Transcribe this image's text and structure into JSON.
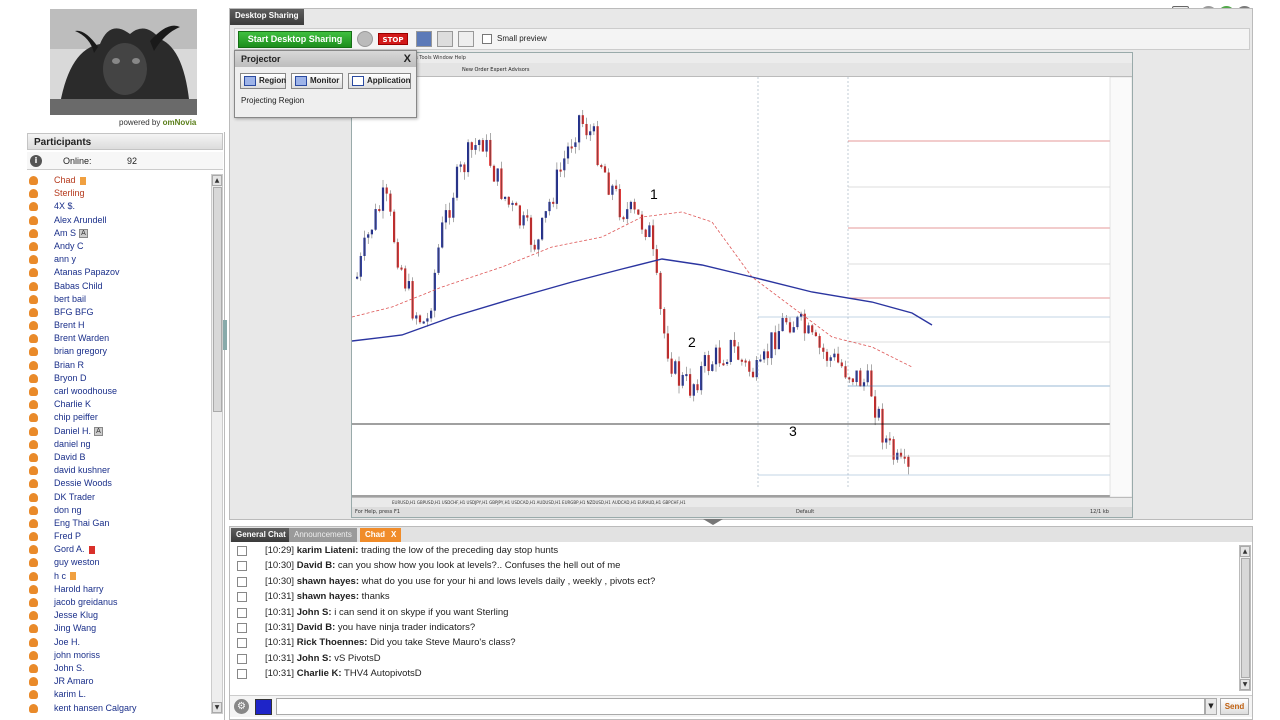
{
  "logo": {
    "powered_by": "powered by",
    "brand": "omNovia"
  },
  "participants": {
    "header": "Participants",
    "online_label": "Online:",
    "online_count": "92",
    "items": [
      {
        "name": "Chad",
        "hl": true,
        "badge": "orange"
      },
      {
        "name": "Sterling",
        "hl": true
      },
      {
        "name": "4X $."
      },
      {
        "name": "Alex Arundell"
      },
      {
        "name": "Am S",
        "badge": "A"
      },
      {
        "name": "Andy C"
      },
      {
        "name": "ann y"
      },
      {
        "name": "Atanas Papazov"
      },
      {
        "name": "Babas Child"
      },
      {
        "name": "bert bail"
      },
      {
        "name": "BFG BFG"
      },
      {
        "name": "Brent H"
      },
      {
        "name": "Brent Warden"
      },
      {
        "name": "brian gregory"
      },
      {
        "name": "Brian R"
      },
      {
        "name": "Bryon D"
      },
      {
        "name": "carl woodhouse"
      },
      {
        "name": "Charlie K"
      },
      {
        "name": "chip peiffer"
      },
      {
        "name": "Daniel H.",
        "badge": "A"
      },
      {
        "name": "daniel ng"
      },
      {
        "name": "David B"
      },
      {
        "name": "david kushner"
      },
      {
        "name": "Dessie Woods"
      },
      {
        "name": "DK Trader"
      },
      {
        "name": "don ng"
      },
      {
        "name": "Eng Thai Gan"
      },
      {
        "name": "Fred P"
      },
      {
        "name": "Gord A.",
        "badge": "red"
      },
      {
        "name": "guy weston"
      },
      {
        "name": "h c",
        "badge": "orange"
      },
      {
        "name": "Harold harry"
      },
      {
        "name": "jacob greidanus"
      },
      {
        "name": "Jesse  Klug"
      },
      {
        "name": "Jing Wang"
      },
      {
        "name": "Joe H."
      },
      {
        "name": "john moriss"
      },
      {
        "name": "John S."
      },
      {
        "name": "JR Amaro"
      },
      {
        "name": "karim L."
      },
      {
        "name": "kent hansen  Calgary"
      }
    ]
  },
  "desktop_sharing": {
    "tab": "Desktop Sharing",
    "start_label": "Start Desktop Sharing",
    "stop_label": "STOP",
    "small_preview": "Small preview"
  },
  "projector": {
    "title": "Projector",
    "close": "X",
    "region": "Region",
    "monitor": "Monitor",
    "application": "Application",
    "status": "Projecting Region"
  },
  "chart_overlay": {
    "label1": "1",
    "label2": "2",
    "label3": "3"
  },
  "mt": {
    "menus": "File  View  Insert  Charts  Tools  Window  Help",
    "toolbar": "New Order   Expert Advisors",
    "tabs": "EURUSD,H1  GBPUSD,H1  USDCHF,H1  USDJPY,H1  GBPJPY,H1  USDCAD,H1  AUDUSD,H1  EURGBP,H1  NZDUSD,H1  AUDCAD,H1  EURAUD,H1  GBPCHF,H1",
    "status_left": "For Help, press F1",
    "status_mid": "Default",
    "status_right": "12/1 kb"
  },
  "chat": {
    "tab_general": "General Chat",
    "tab_announcements": "Announcements",
    "tab_chad": "Chad",
    "tab_chad_close": "X",
    "messages": [
      {
        "time": "[10:29]",
        "who": "karim Liateni:",
        "text": "trading the low of the preceding day stop hunts"
      },
      {
        "time": "[10:30]",
        "who": "David B:",
        "text": "can you show how you look at levels?.. Confuses the hell out of me"
      },
      {
        "time": "[10:30]",
        "who": "shawn  hayes:",
        "text": "what do you use for your hi and lows levels daily , weekly , pivots ect?"
      },
      {
        "time": "[10:31]",
        "who": "shawn  hayes:",
        "text": "thanks"
      },
      {
        "time": "[10:31]",
        "who": "John S:",
        "text": "i can send it on skype if you want Sterling"
      },
      {
        "time": "[10:31]",
        "who": "David B:",
        "text": "you have ninja trader indicators?"
      },
      {
        "time": "[10:31]",
        "who": "Rick Thoennes:",
        "text": "Did you take Steve Mauro's class?"
      },
      {
        "time": "[10:31]",
        "who": "John S:",
        "text": "vS PivotsD"
      },
      {
        "time": "[10:31]",
        "who": "Charlie K:",
        "text": "THV4 AutopivotsD"
      }
    ],
    "input_value": "",
    "send_label": "Send"
  },
  "colors": {
    "accent_orange": "#f08c2a",
    "start_green": "#1d8e1d",
    "stop_red": "#d21a1a",
    "ma_blue": "#2b35a0"
  }
}
